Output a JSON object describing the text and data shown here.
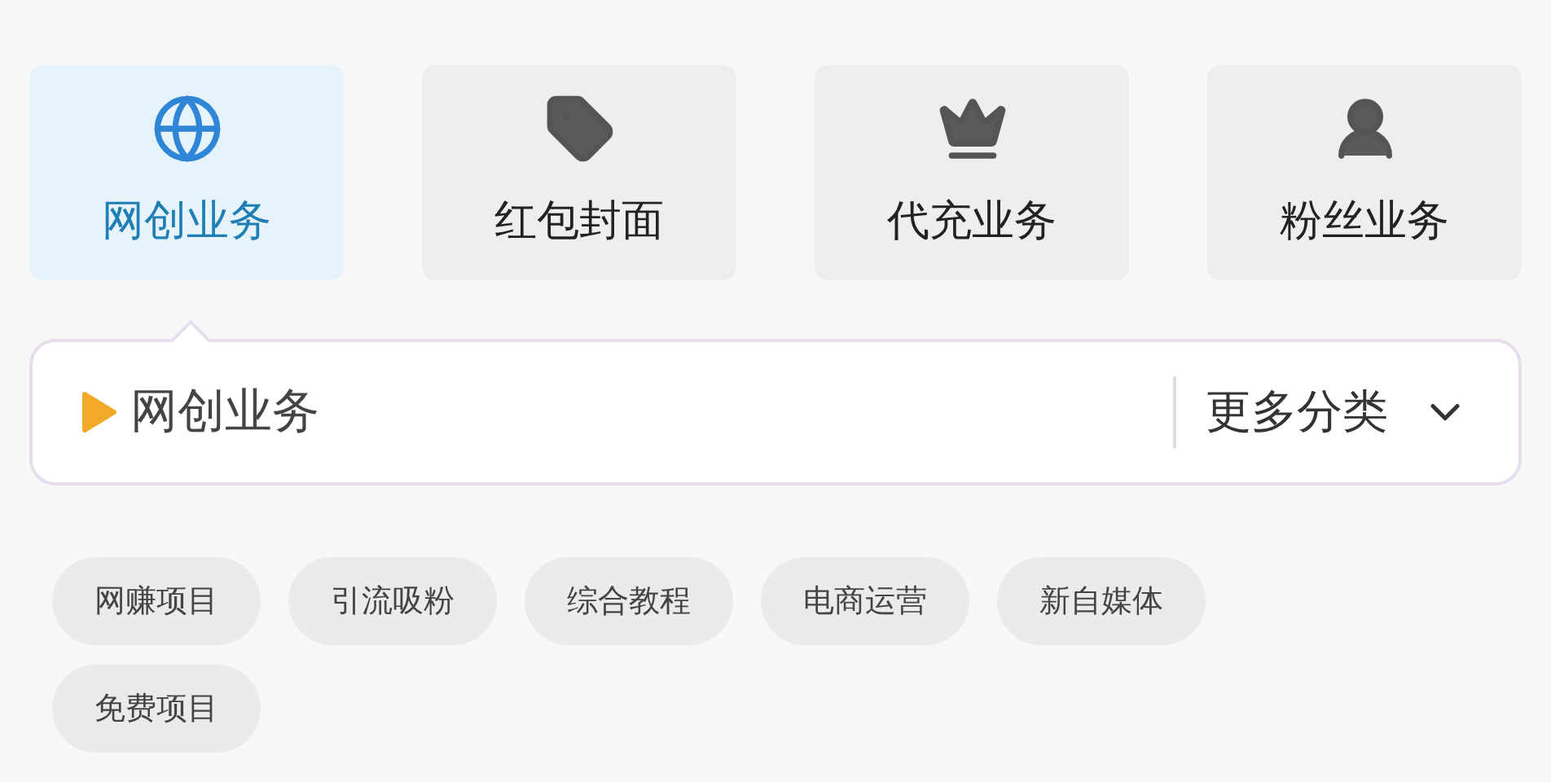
{
  "categories": [
    {
      "label": "网创业务",
      "selected": true,
      "kind": "globe"
    },
    {
      "label": "红包封面",
      "selected": false,
      "kind": "tag"
    },
    {
      "label": "代充业务",
      "selected": false,
      "kind": "crown"
    },
    {
      "label": "粉丝业务",
      "selected": false,
      "kind": "user"
    }
  ],
  "current": {
    "label": "网创业务"
  },
  "more": {
    "label": "更多分类"
  },
  "tags": [
    "网赚项目",
    "引流吸粉",
    "综合教程",
    "电商运营",
    "新自媒体",
    "免费项目"
  ]
}
